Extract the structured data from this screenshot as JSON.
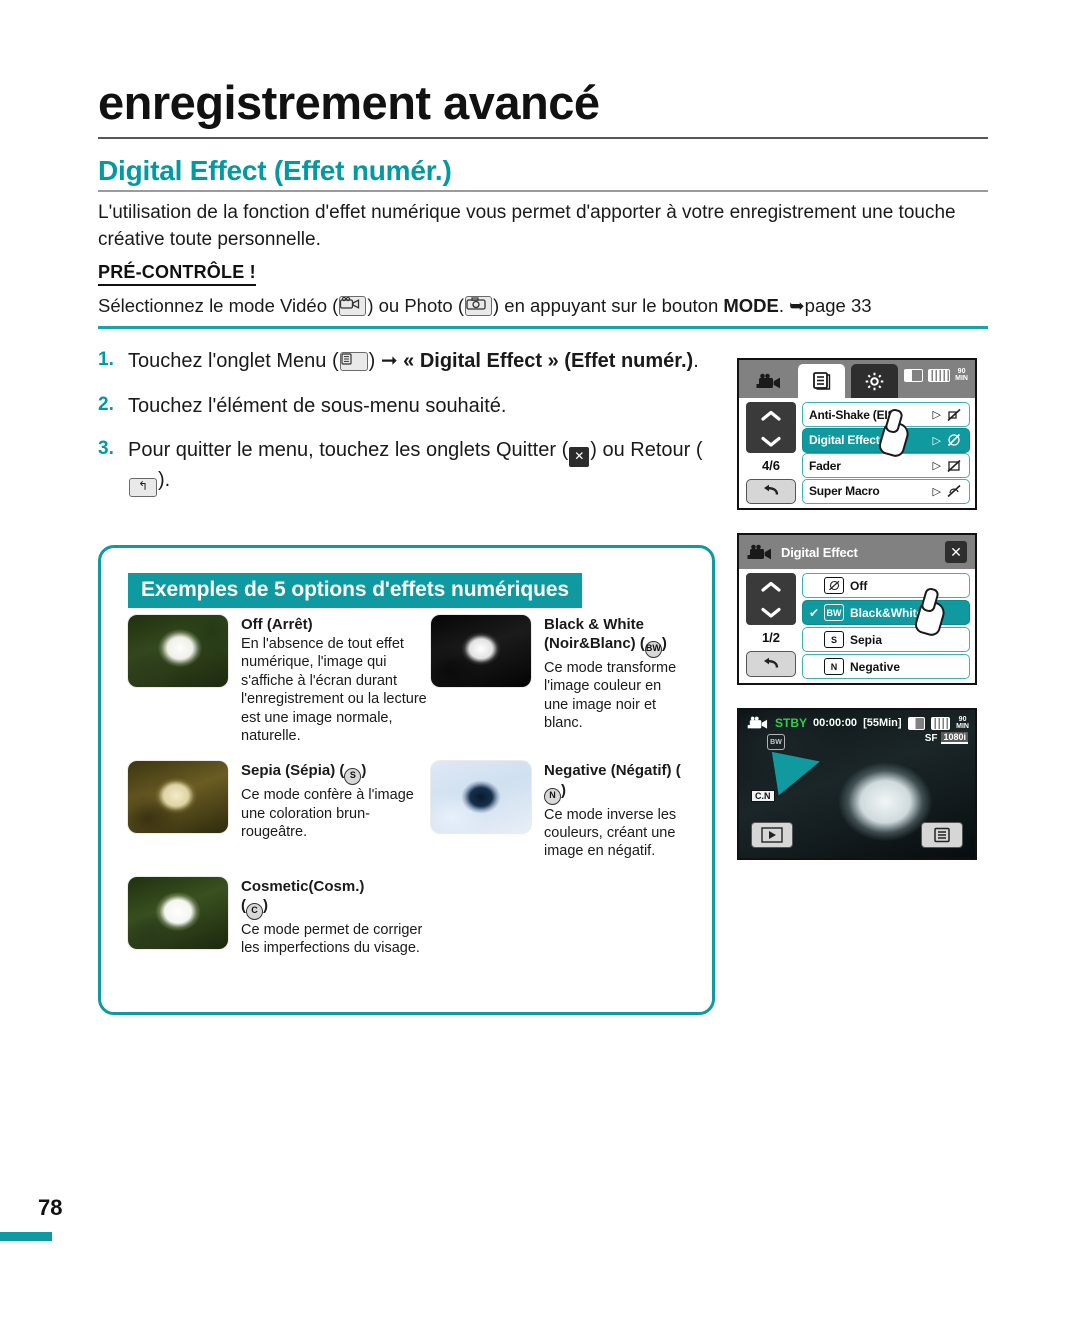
{
  "header": {
    "chapter": "enregistrement avancé",
    "section": "Digital Effect (Effet numér.)",
    "intro": "L'utilisation de la fonction d'effet numérique vous permet d'apporter à votre enregistrement une touche créative toute personnelle.",
    "precheck_label": "PRÉ-CONTRÔLE !",
    "precheck_before": "Sélectionnez le mode Vidéo (",
    "precheck_mid": ") ou Photo (",
    "precheck_after": ") en appuyant sur le bouton ",
    "precheck_mode": "MODE",
    "precheck_page": ". ➥page 33"
  },
  "steps": [
    {
      "num": "1.",
      "part1": "Touchez l'onglet Menu (",
      "part2": ") ➞ ",
      "bold": "« Digital Effect » (Effet numér.)",
      "part3": "."
    },
    {
      "num": "2.",
      "part1": "Touchez l'élément de sous-menu souhaité.",
      "part2": "",
      "bold": "",
      "part3": ""
    },
    {
      "num": "3.",
      "part1": "Pour quitter le menu, touchez les onglets Quitter (",
      "part2": ") ou Retour (",
      "bold": "",
      "part3": ")."
    }
  ],
  "examples": {
    "heading": "Exemples de 5 options d'effets numériques",
    "items": [
      {
        "title": "Off (Arrêt)",
        "glyph": "",
        "body": "En l'absence de tout effet numérique, l'image qui s'affiche à l'écran durant l'enregistrement ou la lecture est une image normale, naturelle."
      },
      {
        "title": "Black & White (Noir&Blanc)",
        "glyph": "BW",
        "body": "Ce mode transforme l'image couleur en une image noir et blanc."
      },
      {
        "title": "Sepia (Sépia)",
        "glyph": "S",
        "body": "Ce mode confère à l'image une coloration brun-rougeâtre."
      },
      {
        "title": "Negative (Négatif)",
        "glyph": "N",
        "body": "Ce mode inverse les couleurs, créant une image en négatif."
      },
      {
        "title": "Cosmetic(Cosm.)",
        "glyph": "C",
        "body": "Ce mode permet de corriger les imperfections du visage."
      }
    ]
  },
  "lcd_menu": {
    "page_indicator": "4/6",
    "items": [
      {
        "label": "Anti-Shake (EIS)",
        "arrow": "▷",
        "glyph": "EIS",
        "selected": false
      },
      {
        "label": "Digital Effect",
        "arrow": "▷",
        "glyph": "DE",
        "selected": true
      },
      {
        "label": "Fader",
        "arrow": "▷",
        "glyph": "FD",
        "selected": false
      },
      {
        "label": "Super Macro",
        "arrow": "▷",
        "glyph": "SM",
        "selected": false
      }
    ],
    "status": {
      "minutes": "90",
      "min_label": "MIN"
    }
  },
  "lcd_submenu": {
    "title": "Digital Effect",
    "page_indicator": "1/2",
    "close_label": "✕",
    "items": [
      {
        "label": "Off",
        "glyph": "∅",
        "checked": false,
        "selected": false
      },
      {
        "label": "Black&White",
        "glyph": "BW",
        "checked": true,
        "selected": true
      },
      {
        "label": "Sepia",
        "glyph": "S",
        "checked": false,
        "selected": false
      },
      {
        "label": "Negative",
        "glyph": "N",
        "checked": false,
        "selected": false
      }
    ]
  },
  "lcd_preview": {
    "status": "STBY",
    "timecode": "00:00:00",
    "remaining": "[55Min]",
    "minutes": "90",
    "min_label": "MIN",
    "quality": "SF",
    "resolution": "1080i",
    "effect_indicator": "BW",
    "color_nite": "C.N"
  },
  "footer": {
    "page_number": "78"
  },
  "colors": {
    "accent": "#0e9aa0",
    "section_title": "#009aa2",
    "step_num": "#009aa2",
    "lcd_selected": "#109aa0",
    "lcd_border": "#3ab3b8",
    "stby_green": "#2fcf4c"
  }
}
